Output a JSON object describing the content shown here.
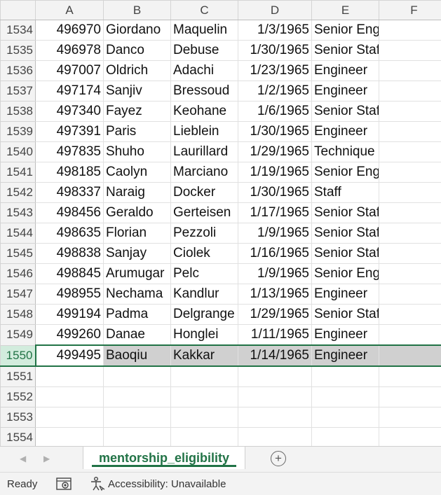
{
  "columns": [
    "A",
    "B",
    "C",
    "D",
    "E",
    "F"
  ],
  "rows": [
    {
      "row": "1534",
      "id": "496970",
      "first": "Giordano",
      "last": "Maquelin",
      "date": "1/3/1965",
      "title": "Senior Engineer"
    },
    {
      "row": "1535",
      "id": "496978",
      "first": "Danco",
      "last": "Debuse",
      "date": "1/30/1965",
      "title": "Senior Staff"
    },
    {
      "row": "1536",
      "id": "497007",
      "first": "Oldrich",
      "last": "Adachi",
      "date": "1/23/1965",
      "title": "Engineer"
    },
    {
      "row": "1537",
      "id": "497174",
      "first": "Sanjiv",
      "last": "Bressoud",
      "date": "1/2/1965",
      "title": "Engineer"
    },
    {
      "row": "1538",
      "id": "497340",
      "first": "Fayez",
      "last": "Keohane",
      "date": "1/6/1965",
      "title": "Senior Staff"
    },
    {
      "row": "1539",
      "id": "497391",
      "first": "Paris",
      "last": "Lieblein",
      "date": "1/30/1965",
      "title": "Engineer"
    },
    {
      "row": "1540",
      "id": "497835",
      "first": "Shuho",
      "last": "Laurillard",
      "date": "1/29/1965",
      "title": "Technique Leader"
    },
    {
      "row": "1541",
      "id": "498185",
      "first": "Caolyn",
      "last": "Marciano",
      "date": "1/19/1965",
      "title": "Senior Engineer"
    },
    {
      "row": "1542",
      "id": "498337",
      "first": "Naraig",
      "last": "Docker",
      "date": "1/30/1965",
      "title": "Staff"
    },
    {
      "row": "1543",
      "id": "498456",
      "first": "Geraldo",
      "last": "Gerteisen",
      "date": "1/17/1965",
      "title": "Senior Staff"
    },
    {
      "row": "1544",
      "id": "498635",
      "first": "Florian",
      "last": "Pezzoli",
      "date": "1/9/1965",
      "title": "Senior Staff"
    },
    {
      "row": "1545",
      "id": "498838",
      "first": "Sanjay",
      "last": "Ciolek",
      "date": "1/16/1965",
      "title": "Senior Staff"
    },
    {
      "row": "1546",
      "id": "498845",
      "first": "Arumugar",
      "last": "Pelc",
      "date": "1/9/1965",
      "title": "Senior Engineer"
    },
    {
      "row": "1547",
      "id": "498955",
      "first": "Nechama",
      "last": "Kandlur",
      "date": "1/13/1965",
      "title": "Engineer"
    },
    {
      "row": "1548",
      "id": "499194",
      "first": "Padma",
      "last": "Delgrange",
      "date": "1/29/1965",
      "title": "Senior Staff"
    },
    {
      "row": "1549",
      "id": "499260",
      "first": "Danae",
      "last": "Honglei",
      "date": "1/11/1965",
      "title": "Engineer"
    },
    {
      "row": "1550",
      "id": "499495",
      "first": "Baoqiu",
      "last": "Kakkar",
      "date": "1/14/1965",
      "title": "Engineer"
    }
  ],
  "empty_rows": [
    "1551",
    "1552",
    "1553",
    "1554"
  ],
  "selected_row": "1550",
  "sheet_tab": {
    "name": "mentorship_eligibility",
    "add_symbol": "+"
  },
  "nav": {
    "left_arrow": "◀",
    "right_arrow": "▶"
  },
  "status": {
    "ready": "Ready",
    "accessibility": "Accessibility: Unavailable"
  },
  "icons": {
    "macro": "macro-recording-icon",
    "accessibility": "accessibility-person-icon"
  },
  "colors": {
    "accent": "#217346",
    "selection": "#d0d0d0",
    "header_bg": "#f3f3f3"
  }
}
